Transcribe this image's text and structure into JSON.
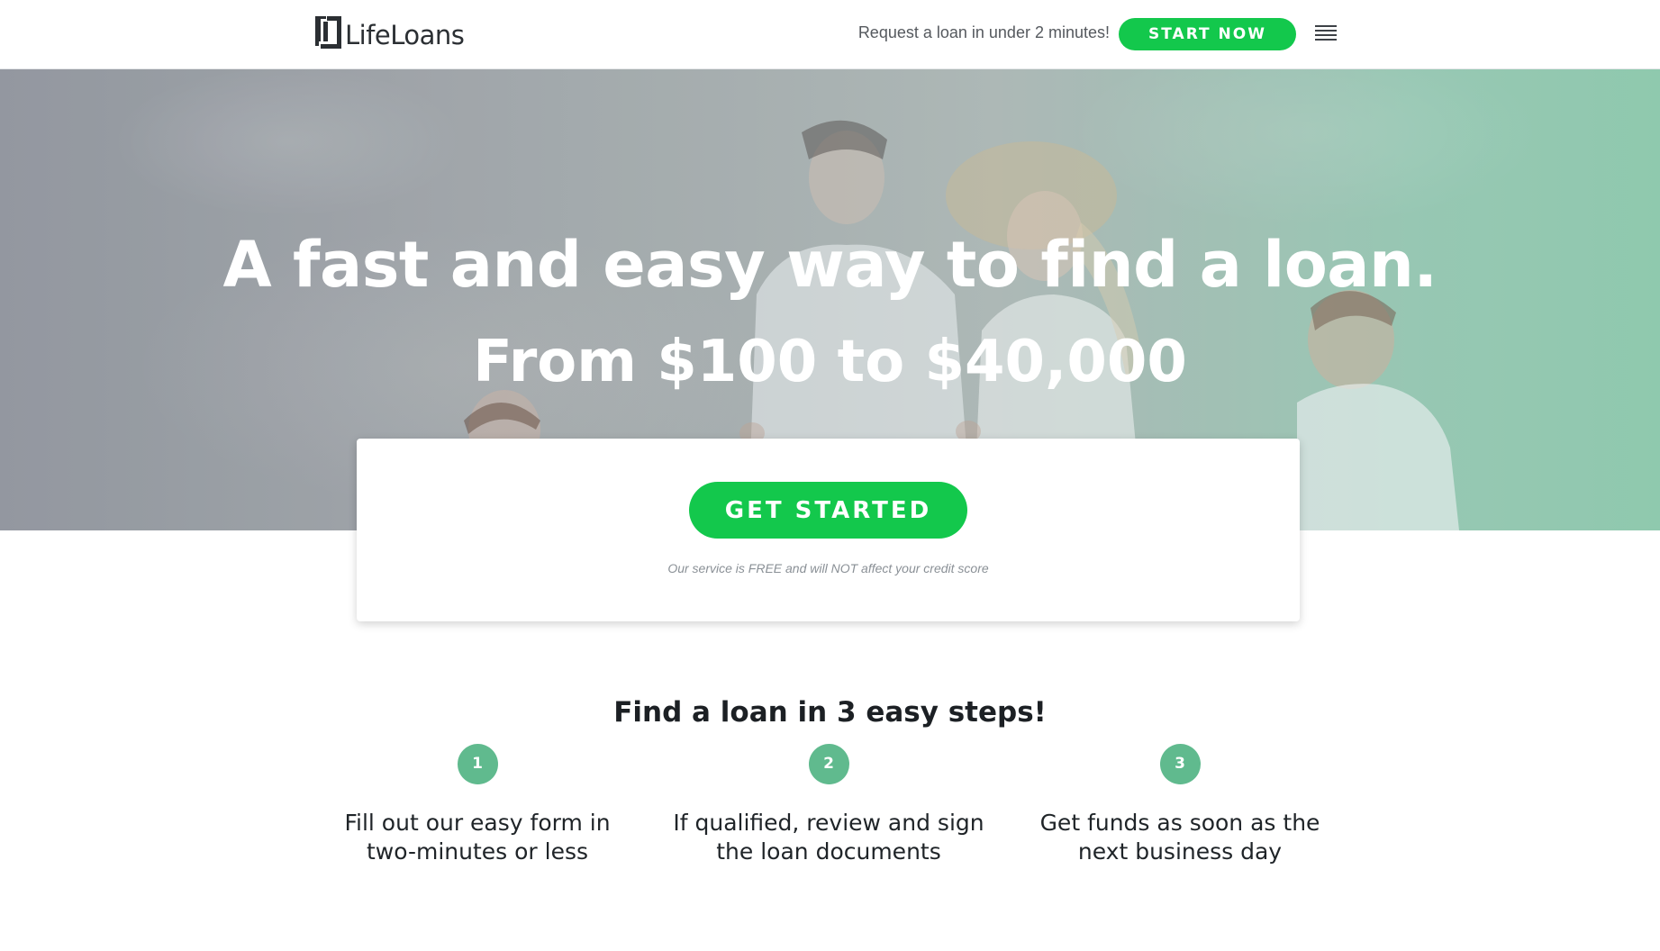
{
  "header": {
    "logo_text": "LifeLoans",
    "tagline": "Request a loan in under 2 minutes!",
    "start_button": "START NOW",
    "menu_icon": "hamburger-menu-icon"
  },
  "hero": {
    "title": "A fast and easy way to find a loan.",
    "subtitle": "From $100 to $40,000"
  },
  "cta": {
    "button": "GET STARTED",
    "disclaimer": "Our service is FREE and will NOT affect your credit score"
  },
  "steps": {
    "heading": "Find a loan in 3 easy steps!",
    "items": [
      {
        "number": "1",
        "text": "Fill out our easy form in two-minutes or less"
      },
      {
        "number": "2",
        "text": "If qualified, review and sign the loan documents"
      },
      {
        "number": "3",
        "text": "Get funds as soon as the next business day"
      }
    ]
  },
  "colors": {
    "accent_green": "#13c84c",
    "step_circle": "#60ba8e"
  }
}
